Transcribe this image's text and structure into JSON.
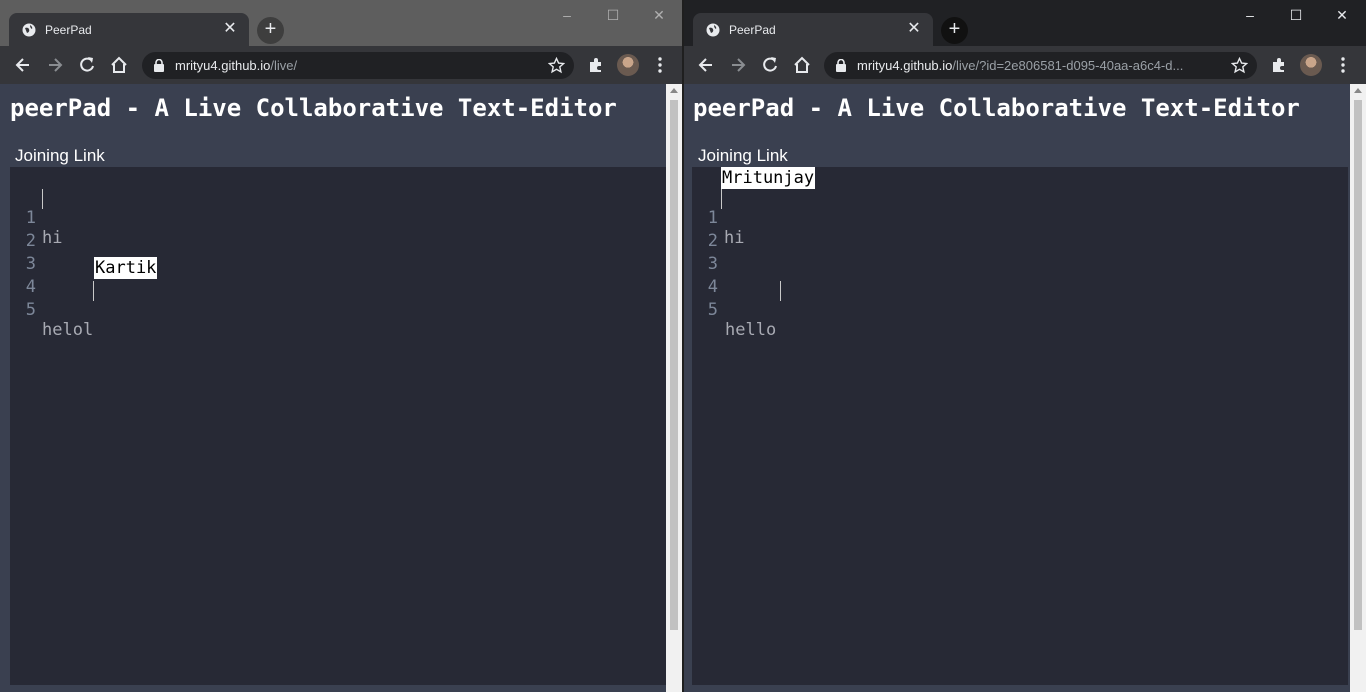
{
  "windows": [
    {
      "tab_title": "PeerPad",
      "url_host": "mrityu4.github.io",
      "url_path": "/live/",
      "page_title": "peerPad - A Live Collaborative Text-Editor",
      "joining_link": "Joining Link",
      "remote_cursor_label": "Kartik",
      "lines": [
        {
          "num": "1",
          "text": "hi"
        },
        {
          "num": "2",
          "text": ""
        },
        {
          "num": "3",
          "text": ""
        },
        {
          "num": "4",
          "text": ""
        },
        {
          "num": "5",
          "text": "helol"
        }
      ]
    },
    {
      "tab_title": "PeerPad",
      "url_host": "mrityu4.github.io",
      "url_path": "/live/?id=2e806581-d095-40aa-a6c4-d...",
      "page_title": "peerPad - A Live Collaborative Text-Editor",
      "joining_link": "Joining Link",
      "remote_cursor_label": "Mritunjay",
      "lines": [
        {
          "num": "1",
          "text": "hi"
        },
        {
          "num": "2",
          "text": ""
        },
        {
          "num": "3",
          "text": ""
        },
        {
          "num": "4",
          "text": ""
        },
        {
          "num": "5",
          "text": "hello"
        }
      ]
    }
  ],
  "icons": [
    "globe-icon",
    "close-icon",
    "plus-icon",
    "back-icon",
    "forward-icon",
    "reload-icon",
    "home-icon",
    "lock-icon",
    "star-icon",
    "extensions-icon",
    "avatar",
    "more-icon",
    "minimize-icon",
    "maximize-icon"
  ]
}
